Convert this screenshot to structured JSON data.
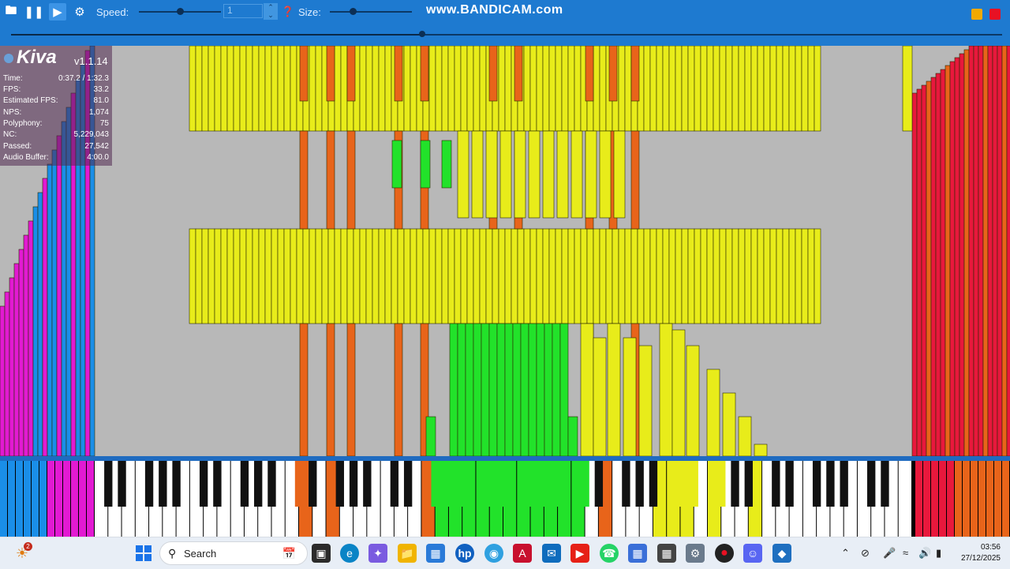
{
  "toolbar": {
    "speed_label": "Speed:",
    "speed_value": "1",
    "speed_slider_fraction": 0.5,
    "size_label": "Size:",
    "size_slider_fraction": 0.28,
    "watermark": "www.BANDICAM.com",
    "playback_progress_fraction": 0.415,
    "icons": [
      "folder-icon",
      "pause-icon",
      "play-icon",
      "gear-icon",
      "help-icon"
    ],
    "window_button_colors": [
      "#f2a900",
      "#e81123"
    ]
  },
  "info_panel": {
    "app_name": "Kiva",
    "version": "v1.1.14",
    "stats": [
      {
        "key": "Time:",
        "value": "0:37.2 / 1:32.3"
      },
      {
        "key": "FPS:",
        "value": "33.2"
      },
      {
        "key": "Estimated FPS:",
        "value": "81.0"
      },
      {
        "key": "NPS:",
        "value": "1,074"
      },
      {
        "key": "Polyphony:",
        "value": "75"
      },
      {
        "key": "NC:",
        "value": "5,229,043"
      },
      {
        "key": "Passed:",
        "value": "27,542"
      },
      {
        "key": "Audio Buffer:",
        "value": "4:00.0"
      }
    ]
  },
  "colors": {
    "toolbar": "#1e7ad0",
    "yellow": "#e8ec1a",
    "orange": "#e8641a",
    "green": "#22e22a",
    "magenta": "#e21ad2",
    "blue": "#1a8ee8",
    "red": "#e8183c"
  },
  "taskbar": {
    "search_placeholder": "Search",
    "time": "03:56",
    "date": "27/12/2025",
    "notification_badge": "2",
    "apps": [
      "start-icon",
      "search-icon",
      "calendar-widget-icon",
      "task-view-icon",
      "edge-icon",
      "copilot-icon",
      "file-explorer-icon",
      "store-icon",
      "hp-icon",
      "chrome-icon",
      "acrobat-icon",
      "outlook-icon",
      "youtube-icon",
      "whatsapp-icon",
      "app-icon",
      "calculator-icon",
      "settings-icon",
      "bandicam-record-icon",
      "discord-icon",
      "kiva-icon"
    ],
    "tray": [
      "chevron-up-icon",
      "network-off-icon",
      "microphone-icon",
      "wifi-icon",
      "volume-icon",
      "battery-icon"
    ]
  }
}
